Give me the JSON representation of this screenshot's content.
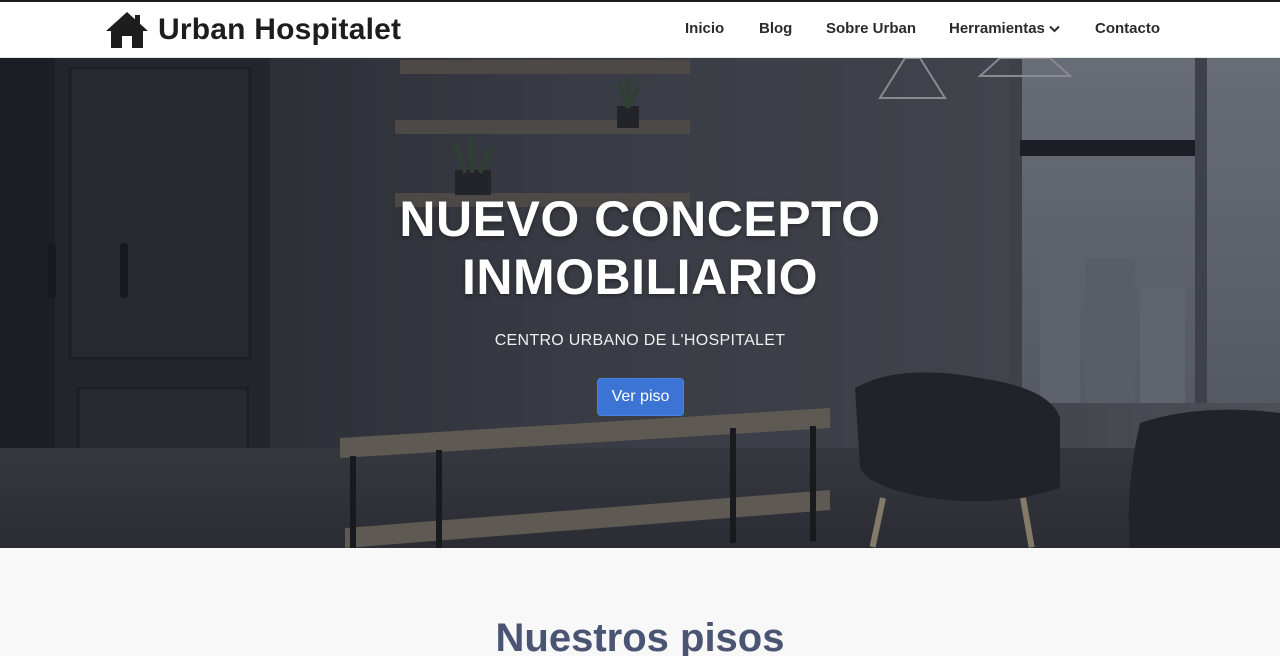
{
  "brand": {
    "name": "Urban Hospitalet",
    "icon": "house-icon"
  },
  "nav": {
    "items": [
      {
        "label": "Inicio"
      },
      {
        "label": "Blog"
      },
      {
        "label": "Sobre Urban"
      },
      {
        "label": "Herramientas",
        "icon": "chevron-down-icon"
      },
      {
        "label": "Contacto"
      }
    ]
  },
  "hero": {
    "title": "NUEVO CONCEPTO INMOBILIARIO",
    "subtitle": "CENTRO URBANO DE L'HOSPITALET",
    "button_label": "Ver piso"
  },
  "section": {
    "title": "Nuestros pisos"
  },
  "colors": {
    "accent": "#3b74d4",
    "section_title": "#4a5473",
    "nav_text": "#2b2b2b",
    "page_bg": "#f8f8f8"
  }
}
